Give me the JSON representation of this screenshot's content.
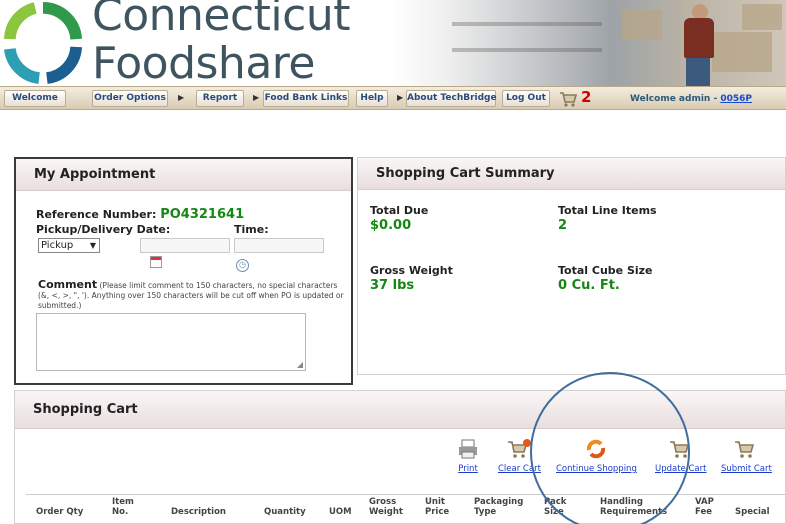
{
  "brand": {
    "line1": "Connecticut",
    "line2": "Foodshare"
  },
  "nav": {
    "items": [
      "Welcome",
      "Order Options",
      "Report",
      "Food Bank Links",
      "Help",
      "About TechBridge",
      "Log Out"
    ],
    "cart_count": "2",
    "welcome_prefix": "Welcome admin - ",
    "welcome_user": "0056P"
  },
  "appointment": {
    "title": "My Appointment",
    "ref_label": "Reference Number:",
    "ref_value": "PO4321641",
    "date_label": "Pickup/Delivery Date:",
    "time_label": "Time:",
    "pickup_option": "Pickup",
    "comment_label": "Comment",
    "comment_note": "(Please limit comment to 150 characters, no special characters (&, <, >, \", '). Anything over 150 characters will be cut off when PO is updated or submitted.)"
  },
  "summary": {
    "title": "Shopping Cart Summary",
    "total_due_label": "Total Due",
    "total_due": "$0.00",
    "line_items_label": "Total Line Items",
    "line_items": "2",
    "gross_weight_label": "Gross Weight",
    "gross_weight": "37 lbs",
    "cube_size_label": "Total Cube Size",
    "cube_size": "0 Cu. Ft."
  },
  "cart": {
    "title": "Shopping Cart",
    "actions": [
      "Print",
      "Clear Cart",
      "Continue Shopping",
      "Update Cart",
      "Submit Cart"
    ],
    "columns": [
      "Order Qty",
      "Item No.",
      "Description",
      "Quantity",
      "UOM",
      "Gross Weight",
      "Unit Price",
      "Packaging Type",
      "Pack Size",
      "Handling Requirements",
      "VAP Fee",
      "Special"
    ]
  },
  "colors": {
    "accent_green": "#148814",
    "nav_text": "#2b4a7a",
    "cart_count_red": "#d00000",
    "link_blue": "#1a3ccc"
  },
  "icons": [
    "logo-ring-icon",
    "cart-icon",
    "calendar-icon",
    "clock-icon",
    "print-icon",
    "clear-cart-icon",
    "continue-shopping-icon",
    "update-cart-icon",
    "submit-cart-icon"
  ]
}
